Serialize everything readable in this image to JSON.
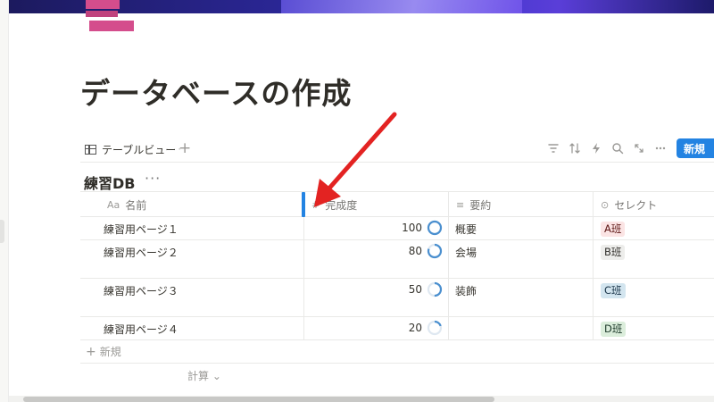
{
  "page": {
    "title": "データベースの作成",
    "cover_colors": [
      "#1c1a5e",
      "#3a33c8",
      "#5a3ed8"
    ],
    "icon_color": "#d44d8c"
  },
  "viewbar": {
    "tab_label": "テーブルビュー",
    "tab_icon": "table-icon",
    "add_view_label": "+",
    "tools": [
      "filter-icon",
      "sort-icon",
      "lightning-icon",
      "search-icon",
      "expand-icon",
      "more-icon"
    ],
    "new_label": "新規",
    "new_color": "#2383e2"
  },
  "database": {
    "title": "練習DB",
    "more_label": "···",
    "columns": [
      {
        "icon": "Aa",
        "label": "名前"
      },
      {
        "icon": "#",
        "label": "完成度"
      },
      {
        "icon": "≡",
        "label": "要約"
      },
      {
        "icon": "⊙",
        "label": "セレクト"
      }
    ],
    "rows": [
      {
        "name": "練習用ページ１",
        "progress": 100,
        "summary": "概要",
        "select": "A班",
        "select_bg": "#fbe4e4",
        "select_fg": "#5d1715"
      },
      {
        "name": "練習用ページ２",
        "progress": 80,
        "summary": "会場",
        "select": "B班",
        "select_bg": "#ededeb",
        "select_fg": "#32302c"
      },
      {
        "name": "練習用ページ３",
        "progress": 50,
        "summary": "装飾",
        "select": "C班",
        "select_bg": "#d3e5ef",
        "select_fg": "#183347"
      },
      {
        "name": "練習用ページ４",
        "progress": 20,
        "summary": "",
        "select": "D班",
        "select_bg": "#dbeddb",
        "select_fg": "#1c3829"
      }
    ],
    "add_row_label": "新規",
    "calc_label": "計算 ⌄"
  },
  "annotation": {
    "color": "#e32322"
  }
}
